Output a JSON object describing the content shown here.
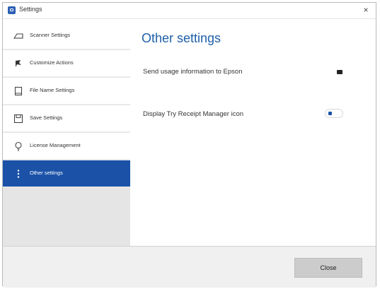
{
  "window": {
    "title": "Settings",
    "close_glyph": "×"
  },
  "sidebar": {
    "items": [
      {
        "label": "Scanner Settings",
        "icon": "scanner-icon",
        "active": false
      },
      {
        "label": "Customize Actions",
        "icon": "pushpin-icon",
        "active": false
      },
      {
        "label": "File Name Settings",
        "icon": "file-icon",
        "active": false
      },
      {
        "label": "Save Settings",
        "icon": "save-icon",
        "active": false
      },
      {
        "label": "License Management",
        "icon": "lightbulb-icon",
        "active": false
      },
      {
        "label": "Other settings",
        "icon": "more-vertical-icon",
        "active": true
      }
    ]
  },
  "main": {
    "title": "Other settings",
    "settings": [
      {
        "label": "Send usage information to Epson",
        "state": "off"
      },
      {
        "label": "Display Try Receipt Manager icon",
        "state": "on"
      }
    ]
  },
  "footer": {
    "close_label": "Close"
  },
  "colors": {
    "accent": "#1b52a8",
    "title": "#1d5fa8",
    "sidebar_bg": "#e5e5e5",
    "footer_bg": "#f0f0f0"
  }
}
